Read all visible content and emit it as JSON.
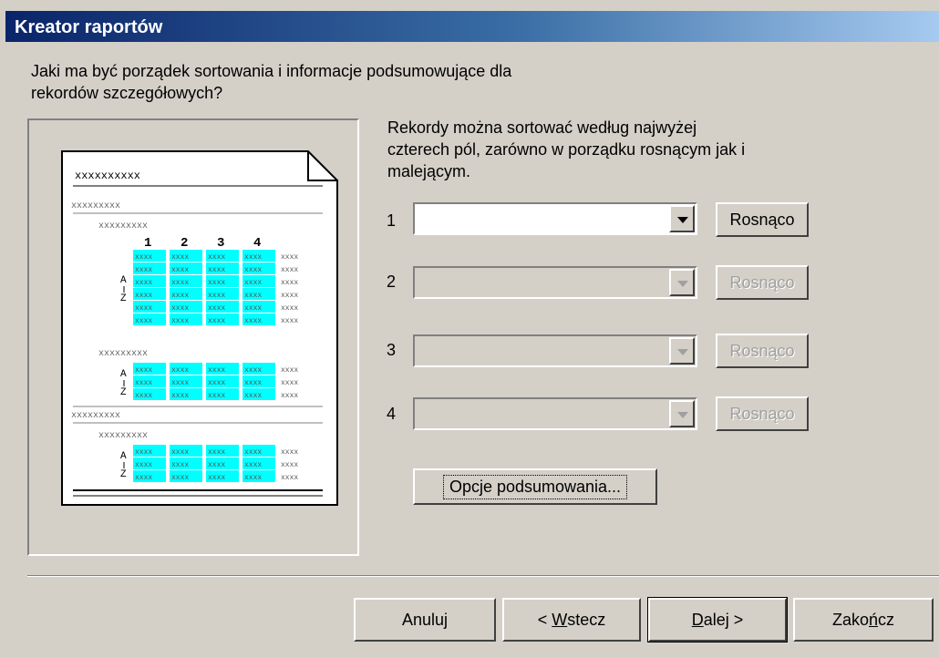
{
  "window": {
    "title": "Kreator raportów"
  },
  "prompt": {
    "line1": "Jaki ma być porządek sortowania i informacje podsumowujące dla",
    "line2": "rekordów szczegółowych?"
  },
  "info": {
    "line1": "Rekordy można sortować według najwyżej",
    "line2": "czterech pól, zarówno w porządku rosnącym jak i",
    "line3": "malejącym."
  },
  "preview": {
    "placeholder": "xxxxxxxxxx",
    "short_placeholder": "xxxxxxxxx",
    "cell": "xxxx",
    "cols": [
      "1",
      "2",
      "3",
      "4"
    ],
    "sort_top": "A",
    "sort_bottom": "Z"
  },
  "sort_rows": [
    {
      "num": "1",
      "order": "Rosnąco",
      "value": ""
    },
    {
      "num": "2",
      "order": "Rosnąco",
      "value": ""
    },
    {
      "num": "3",
      "order": "Rosnąco",
      "value": ""
    },
    {
      "num": "4",
      "order": "Rosnąco",
      "value": ""
    }
  ],
  "summary_options": "Opcje podsumowania...",
  "buttons": {
    "cancel": "Anuluj",
    "back_pre": "< ",
    "back_key": "W",
    "back_post": "stecz",
    "next_key": "D",
    "next_post": "alej >",
    "finish_pre": "Zako",
    "finish_key": "ń",
    "finish_post": "cz"
  },
  "colors": {
    "titlebar_start": "#0a246a",
    "titlebar_end": "#a6caf0",
    "highlight": "#00ffff"
  }
}
